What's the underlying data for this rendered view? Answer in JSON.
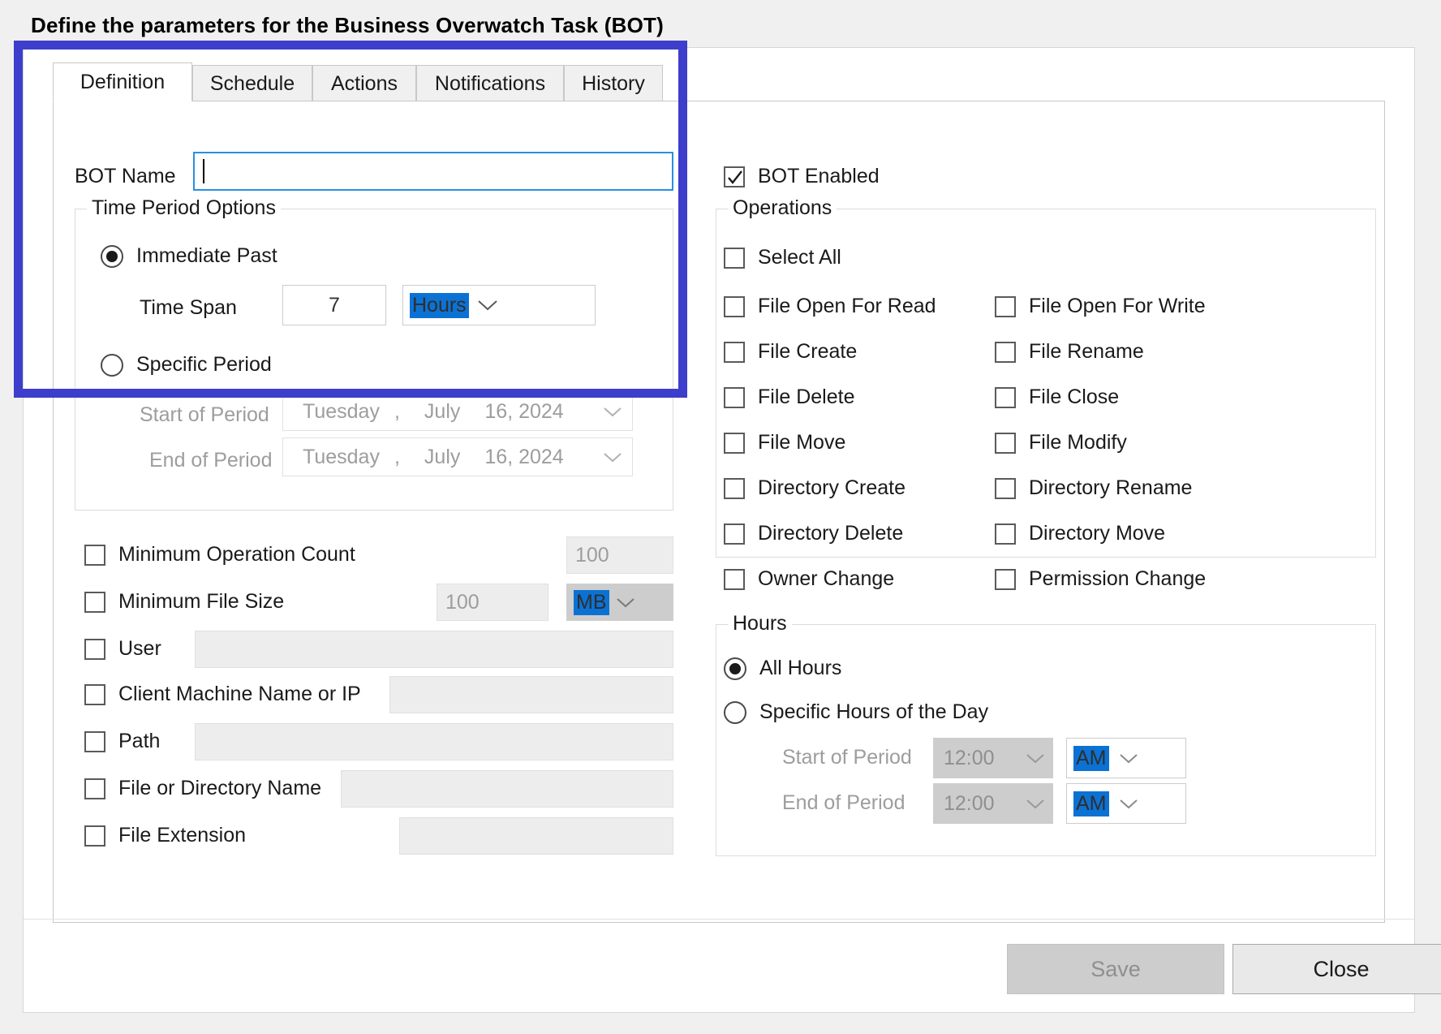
{
  "page": {
    "title": "Define the parameters for the Business Overwatch Task (BOT)",
    "highlight_color": "#3d3ecb",
    "accent_color": "#0b72d4"
  },
  "tabs": [
    {
      "label": "Definition",
      "active": true
    },
    {
      "label": "Schedule",
      "active": false
    },
    {
      "label": "Actions",
      "active": false
    },
    {
      "label": "Notifications",
      "active": false
    },
    {
      "label": "History",
      "active": false
    }
  ],
  "definition": {
    "bot_name": {
      "label": "BOT Name",
      "value": "",
      "placeholder": ""
    },
    "time_period_options": {
      "title": "Time Period Options",
      "immediate_past": {
        "label": "Immediate Past",
        "selected": true
      },
      "time_span": {
        "label": "Time Span",
        "value": "7",
        "unit": "Hours",
        "unit_selected": true
      },
      "specific_period": {
        "label": "Specific Period",
        "selected": false
      },
      "start_of_period": {
        "label": "Start of Period",
        "weekday": "Tuesday",
        "comma": ",",
        "month": "July",
        "day_year": "16, 2024"
      },
      "end_of_period": {
        "label": "End of Period",
        "weekday": "Tuesday",
        "comma": ",",
        "month": "July",
        "day_year": "16, 2024"
      }
    },
    "filters": [
      {
        "label": "Minimum Operation Count",
        "checked": false,
        "value": "100"
      },
      {
        "label": "Minimum File Size",
        "checked": false,
        "value": "100",
        "unit": "MB"
      },
      {
        "label": "User",
        "checked": false,
        "value": ""
      },
      {
        "label": "Client Machine Name or IP",
        "checked": false,
        "value": ""
      },
      {
        "label": "Path",
        "checked": false,
        "value": ""
      },
      {
        "label": "File or Directory Name",
        "checked": false,
        "value": ""
      },
      {
        "label": "File Extension",
        "checked": false,
        "value": ""
      }
    ]
  },
  "right_panel": {
    "bot_enabled": {
      "label": "BOT Enabled",
      "checked": true
    },
    "operations": {
      "title": "Operations",
      "select_all": {
        "label": "Select All",
        "checked": false
      },
      "left_column": [
        {
          "label": "File Open For Read",
          "checked": false
        },
        {
          "label": "File Create",
          "checked": false
        },
        {
          "label": "File Delete",
          "checked": false
        },
        {
          "label": "File Move",
          "checked": false
        },
        {
          "label": "Directory Create",
          "checked": false
        },
        {
          "label": "Directory Delete",
          "checked": false
        },
        {
          "label": "Owner Change",
          "checked": false
        }
      ],
      "right_column": [
        {
          "label": "File Open For Write",
          "checked": false
        },
        {
          "label": "File Rename",
          "checked": false
        },
        {
          "label": "File Close",
          "checked": false
        },
        {
          "label": "File Modify",
          "checked": false
        },
        {
          "label": "Directory Rename",
          "checked": false
        },
        {
          "label": "Directory Move",
          "checked": false
        },
        {
          "label": "Permission Change",
          "checked": false
        }
      ]
    },
    "hours": {
      "title": "Hours",
      "all_hours": {
        "label": "All Hours",
        "selected": true
      },
      "specific_hours": {
        "label": "Specific Hours of the Day",
        "selected": false
      },
      "start_of_period": {
        "label": "Start of Period",
        "time": "12:00",
        "meridiem": "AM"
      },
      "end_of_period": {
        "label": "End of Period",
        "time": "12:00",
        "meridiem": "AM"
      }
    }
  },
  "footer": {
    "save": {
      "label": "Save",
      "enabled": false
    },
    "close": {
      "label": "Close",
      "enabled": true
    }
  }
}
